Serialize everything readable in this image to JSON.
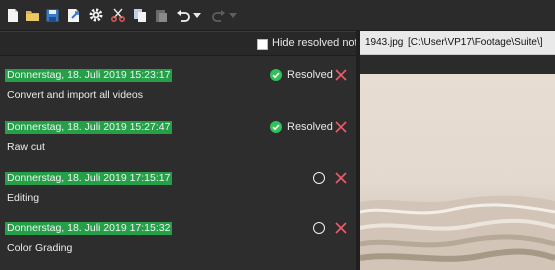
{
  "toolbar": {
    "icons": [
      "new-file-icon",
      "open-folder-icon",
      "save-icon",
      "export-icon",
      "settings-icon",
      "cut-icon",
      "copy-icon",
      "paste-icon",
      "undo-icon",
      "dropdown-icon",
      "redo-icon",
      "dropdown-icon"
    ]
  },
  "notes_panel": {
    "hide_resolved_label": "Hide resolved notes",
    "hide_resolved_checked": false,
    "items": [
      {
        "date": "Donnerstag, 18. Juli 2019 15:23:17",
        "text": "Convert and import all videos",
        "resolved": true,
        "status_label": "Resolved"
      },
      {
        "date": "Donnerstag, 18. Juli 2019 15:27:47",
        "text": "Raw cut",
        "resolved": true,
        "status_label": "Resolved"
      },
      {
        "date": "Donnerstag, 18. Juli 2019 17:15:17",
        "text": "Editing",
        "resolved": false,
        "status_label": ""
      },
      {
        "date": "Donnerstag, 18. Juli 2019 17:15:32",
        "text": "Color Grading",
        "resolved": false,
        "status_label": ""
      }
    ]
  },
  "preview": {
    "file_name": "1943.jpg",
    "file_path": "[C:\\User\\VP17\\Footage\\Suite\\]"
  },
  "colors": {
    "date_badge": "#25a049",
    "resolved": "#2fc15a",
    "delete": "#f05a6c"
  }
}
